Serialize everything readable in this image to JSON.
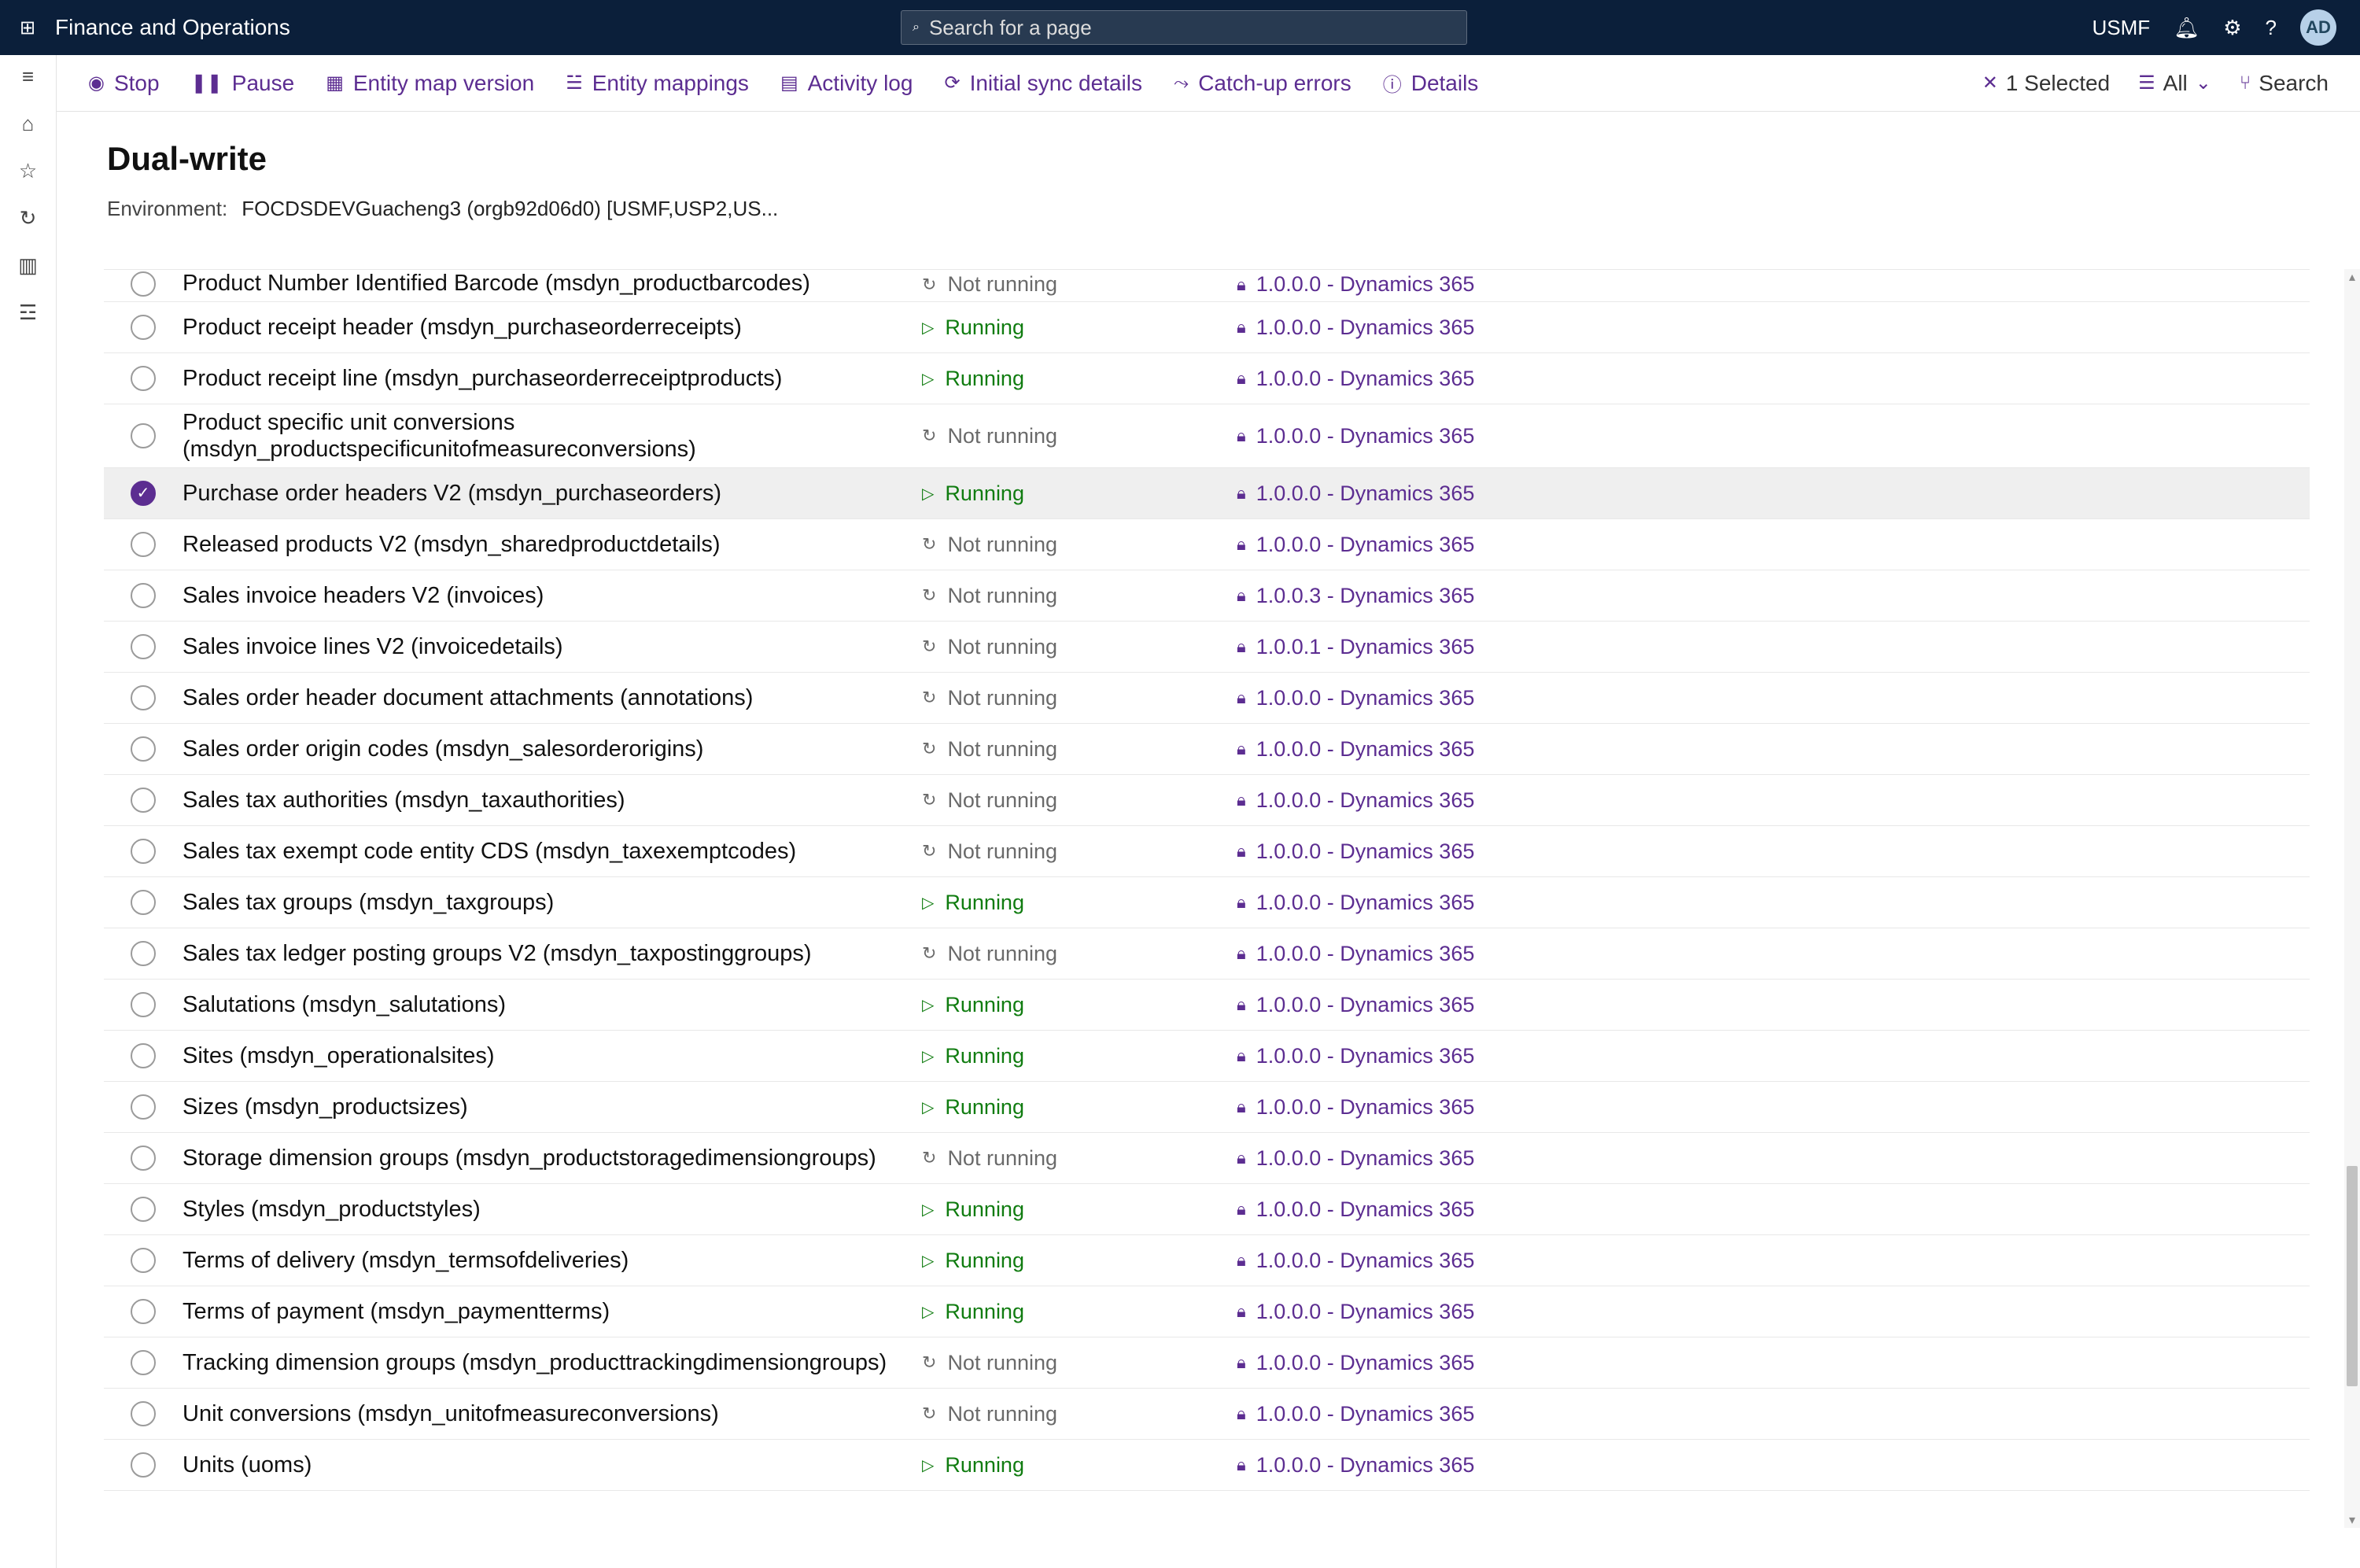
{
  "header": {
    "app_title": "Finance and Operations",
    "search_placeholder": "Search for a page",
    "company": "USMF",
    "user_initials": "AD"
  },
  "toolbar": {
    "stop": "Stop",
    "pause": "Pause",
    "entity_map_version": "Entity map version",
    "entity_mappings": "Entity mappings",
    "activity_log": "Activity log",
    "initial_sync_details": "Initial sync details",
    "catch_up_errors": "Catch-up errors",
    "details": "Details",
    "selected": "1 Selected",
    "all": "All",
    "search": "Search"
  },
  "page": {
    "title": "Dual-write",
    "env_label": "Environment:",
    "env_value": "FOCDSDEVGuacheng3 (orgb92d06d0) [USMF,USP2,US..."
  },
  "status_labels": {
    "running": "Running",
    "notrunning": "Not running"
  },
  "rows": [
    {
      "name": "Product Number Identified Barcode (msdyn_productbarcodes)",
      "status": "notrunning",
      "version": "1.0.0.0 - Dynamics 365",
      "selected": false,
      "truncated": true
    },
    {
      "name": "Product receipt header (msdyn_purchaseorderreceipts)",
      "status": "running",
      "version": "1.0.0.0 - Dynamics 365",
      "selected": false
    },
    {
      "name": "Product receipt line (msdyn_purchaseorderreceiptproducts)",
      "status": "running",
      "version": "1.0.0.0 - Dynamics 365",
      "selected": false
    },
    {
      "name": "Product specific unit conversions (msdyn_productspecificunitofmeasureconversions)",
      "status": "notrunning",
      "version": "1.0.0.0 - Dynamics 365",
      "selected": false
    },
    {
      "name": "Purchase order headers V2 (msdyn_purchaseorders)",
      "status": "running",
      "version": "1.0.0.0 - Dynamics 365",
      "selected": true
    },
    {
      "name": "Released products V2 (msdyn_sharedproductdetails)",
      "status": "notrunning",
      "version": "1.0.0.0 - Dynamics 365",
      "selected": false
    },
    {
      "name": "Sales invoice headers V2 (invoices)",
      "status": "notrunning",
      "version": "1.0.0.3 - Dynamics 365",
      "selected": false
    },
    {
      "name": "Sales invoice lines V2 (invoicedetails)",
      "status": "notrunning",
      "version": "1.0.0.1 - Dynamics 365",
      "selected": false
    },
    {
      "name": "Sales order header document attachments (annotations)",
      "status": "notrunning",
      "version": "1.0.0.0 - Dynamics 365",
      "selected": false
    },
    {
      "name": "Sales order origin codes (msdyn_salesorderorigins)",
      "status": "notrunning",
      "version": "1.0.0.0 - Dynamics 365",
      "selected": false
    },
    {
      "name": "Sales tax authorities (msdyn_taxauthorities)",
      "status": "notrunning",
      "version": "1.0.0.0 - Dynamics 365",
      "selected": false
    },
    {
      "name": "Sales tax exempt code entity CDS (msdyn_taxexemptcodes)",
      "status": "notrunning",
      "version": "1.0.0.0 - Dynamics 365",
      "selected": false
    },
    {
      "name": "Sales tax groups (msdyn_taxgroups)",
      "status": "running",
      "version": "1.0.0.0 - Dynamics 365",
      "selected": false
    },
    {
      "name": "Sales tax ledger posting groups V2 (msdyn_taxpostinggroups)",
      "status": "notrunning",
      "version": "1.0.0.0 - Dynamics 365",
      "selected": false
    },
    {
      "name": "Salutations (msdyn_salutations)",
      "status": "running",
      "version": "1.0.0.0 - Dynamics 365",
      "selected": false
    },
    {
      "name": "Sites (msdyn_operationalsites)",
      "status": "running",
      "version": "1.0.0.0 - Dynamics 365",
      "selected": false
    },
    {
      "name": "Sizes (msdyn_productsizes)",
      "status": "running",
      "version": "1.0.0.0 - Dynamics 365",
      "selected": false
    },
    {
      "name": "Storage dimension groups (msdyn_productstoragedimensiongroups)",
      "status": "notrunning",
      "version": "1.0.0.0 - Dynamics 365",
      "selected": false
    },
    {
      "name": "Styles (msdyn_productstyles)",
      "status": "running",
      "version": "1.0.0.0 - Dynamics 365",
      "selected": false
    },
    {
      "name": "Terms of delivery (msdyn_termsofdeliveries)",
      "status": "running",
      "version": "1.0.0.0 - Dynamics 365",
      "selected": false
    },
    {
      "name": "Terms of payment (msdyn_paymentterms)",
      "status": "running",
      "version": "1.0.0.0 - Dynamics 365",
      "selected": false
    },
    {
      "name": "Tracking dimension groups (msdyn_producttrackingdimensiongroups)",
      "status": "notrunning",
      "version": "1.0.0.0 - Dynamics 365",
      "selected": false
    },
    {
      "name": "Unit conversions (msdyn_unitofmeasureconversions)",
      "status": "notrunning",
      "version": "1.0.0.0 - Dynamics 365",
      "selected": false
    },
    {
      "name": "Units (uoms)",
      "status": "running",
      "version": "1.0.0.0 - Dynamics 365",
      "selected": false
    }
  ]
}
